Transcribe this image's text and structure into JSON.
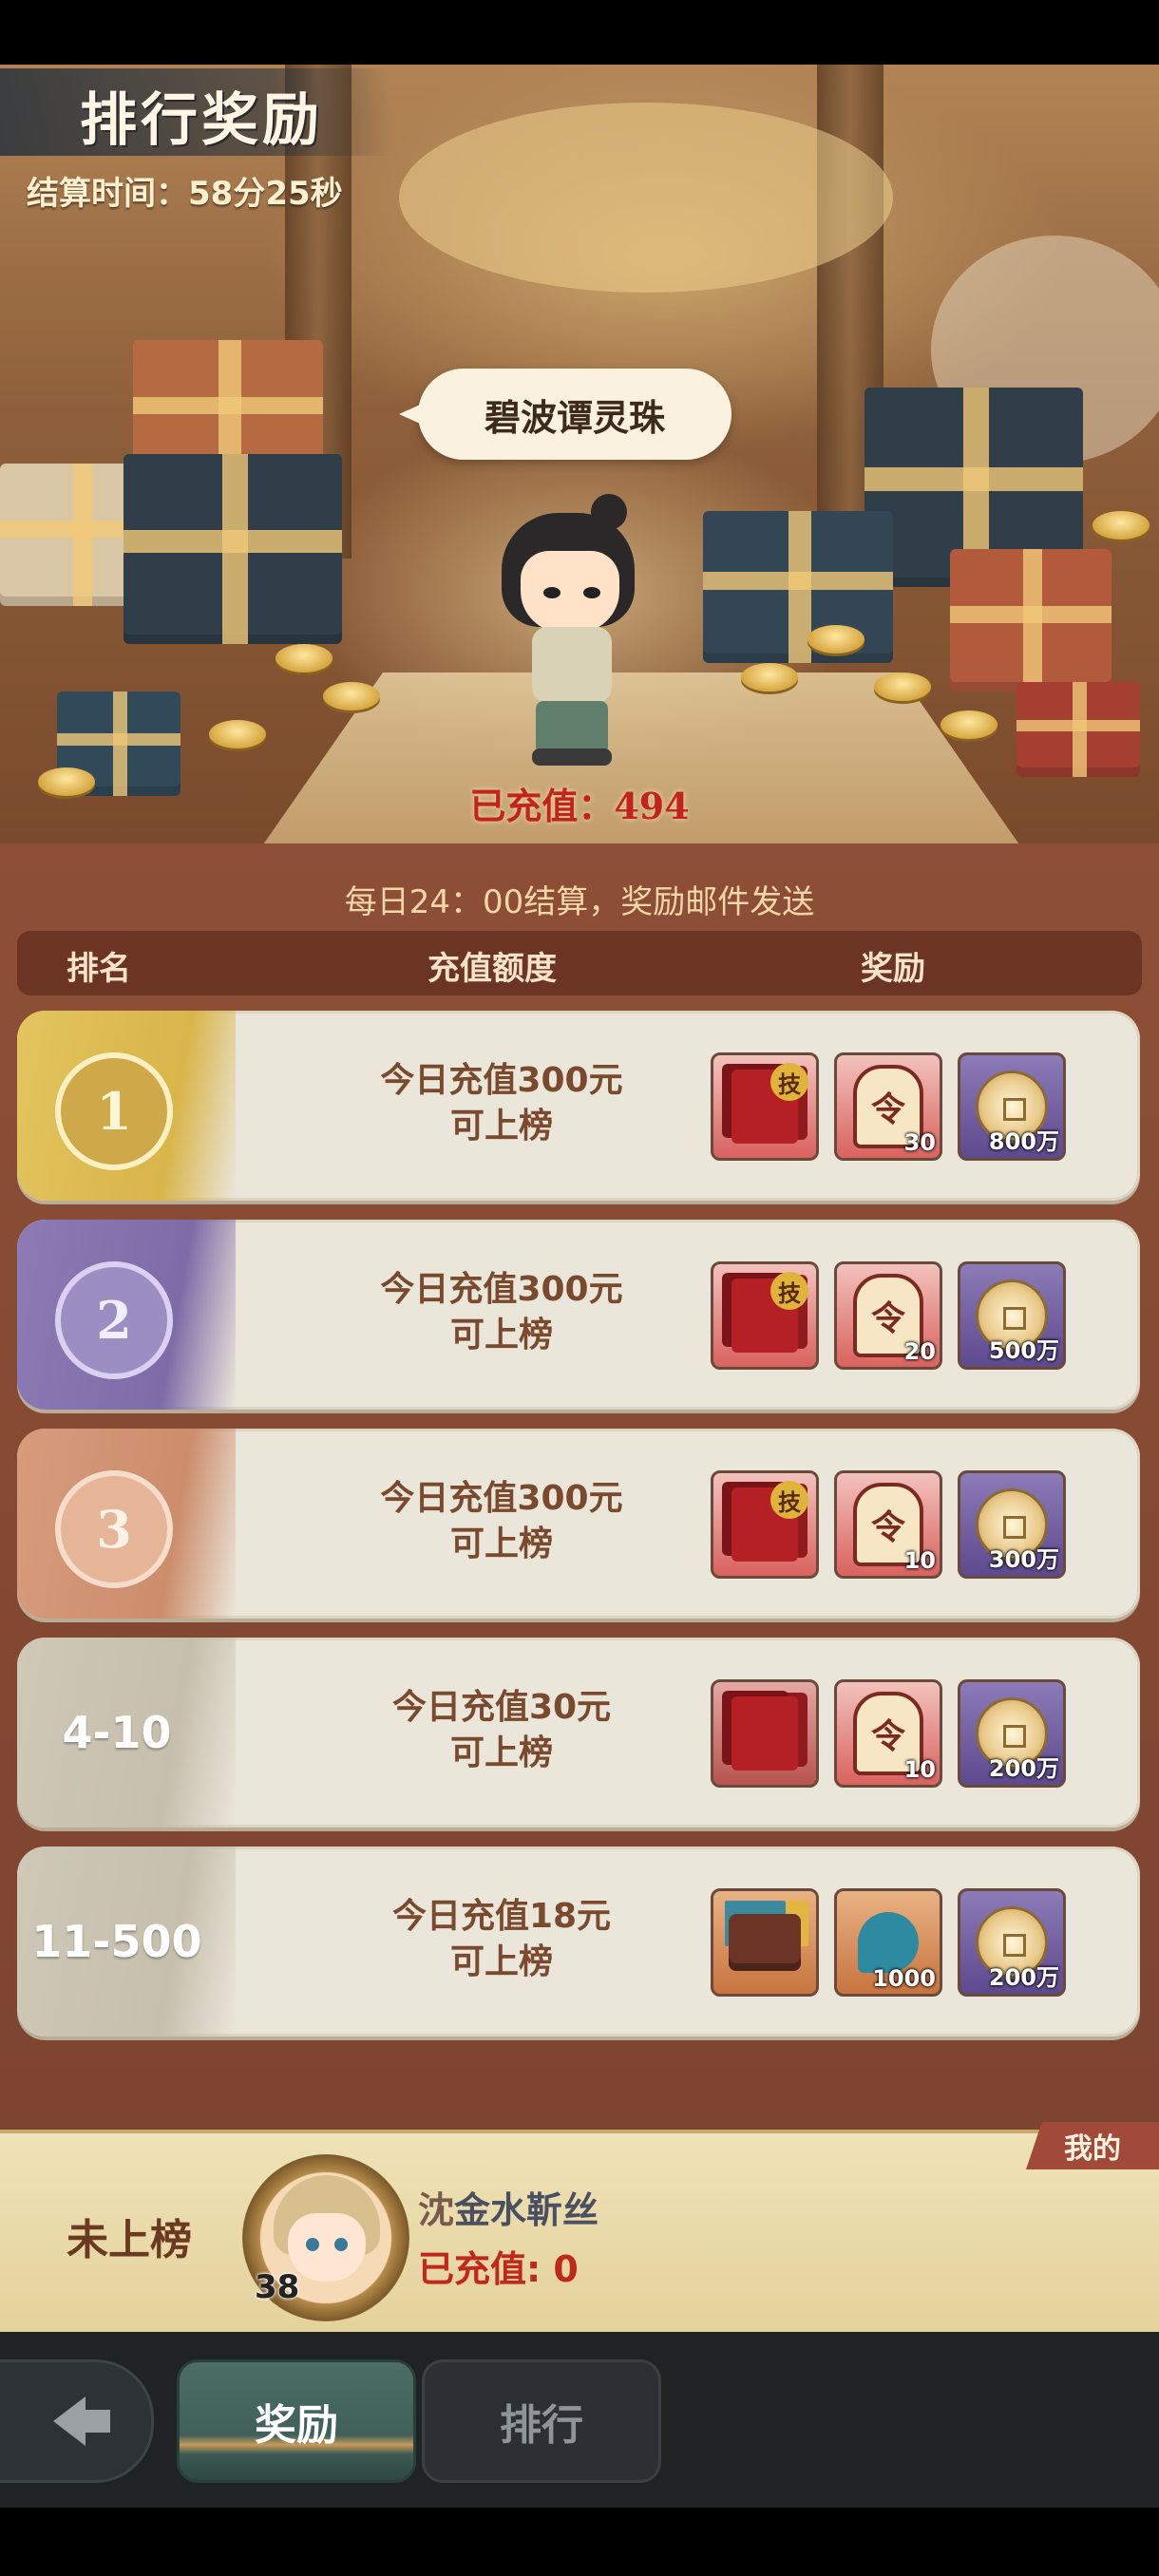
{
  "header": {
    "title": "排行奖励",
    "settle_time": "结算时间：58分25秒"
  },
  "banner": {
    "location_name": "碧波谭灵珠",
    "recharged": "已充值：494"
  },
  "notice": "每日24：00结算，奖励邮件发送",
  "table": {
    "columns": [
      "排名",
      "充值额度",
      "奖励"
    ],
    "rows": [
      {
        "rank": "1",
        "cond_line1": "今日充值300元",
        "cond_line2": "可上榜",
        "rewards": [
          {
            "icon": "skill-cards-icon",
            "label": "技"
          },
          {
            "icon": "token-icon",
            "qty": "30"
          },
          {
            "icon": "copper-coin-icon",
            "qty": "800万"
          }
        ]
      },
      {
        "rank": "2",
        "cond_line1": "今日充值300元",
        "cond_line2": "可上榜",
        "rewards": [
          {
            "icon": "skill-cards-icon",
            "label": "技"
          },
          {
            "icon": "token-icon",
            "qty": "20"
          },
          {
            "icon": "copper-coin-icon",
            "qty": "500万"
          }
        ]
      },
      {
        "rank": "3",
        "cond_line1": "今日充值300元",
        "cond_line2": "可上榜",
        "rewards": [
          {
            "icon": "skill-cards-icon",
            "label": "技"
          },
          {
            "icon": "token-icon",
            "qty": "10"
          },
          {
            "icon": "copper-coin-icon",
            "qty": "300万"
          }
        ]
      },
      {
        "rank": "4-10",
        "cond_line1": "今日充值30元",
        "cond_line2": "可上榜",
        "rewards": [
          {
            "icon": "cards-icon"
          },
          {
            "icon": "token-icon",
            "qty": "10"
          },
          {
            "icon": "copper-coin-icon",
            "qty": "200万"
          }
        ]
      },
      {
        "rank": "11-500",
        "cond_line1": "今日充值18元",
        "cond_line2": "可上榜",
        "rewards": [
          {
            "icon": "treasure-chest-icon"
          },
          {
            "icon": "fish-icon",
            "qty": "1000"
          },
          {
            "icon": "copper-coin-icon",
            "qty": "200万"
          }
        ]
      }
    ]
  },
  "token_char": "令",
  "my": {
    "tag": "我的",
    "status": "未上榜",
    "level": "38",
    "name_prefix": "沈",
    "name_rest": "金水靳丝",
    "recharged": "已充值: 0"
  },
  "tabs": {
    "reward": "奖励",
    "rank": "排行"
  },
  "colors": {
    "gold_rank": "#e3c45e",
    "purple_rank": "#8d7bb6",
    "bronze_rank": "#d79c7c",
    "grey_rank": "#cfc8b6",
    "accent_red": "#c2231a"
  }
}
